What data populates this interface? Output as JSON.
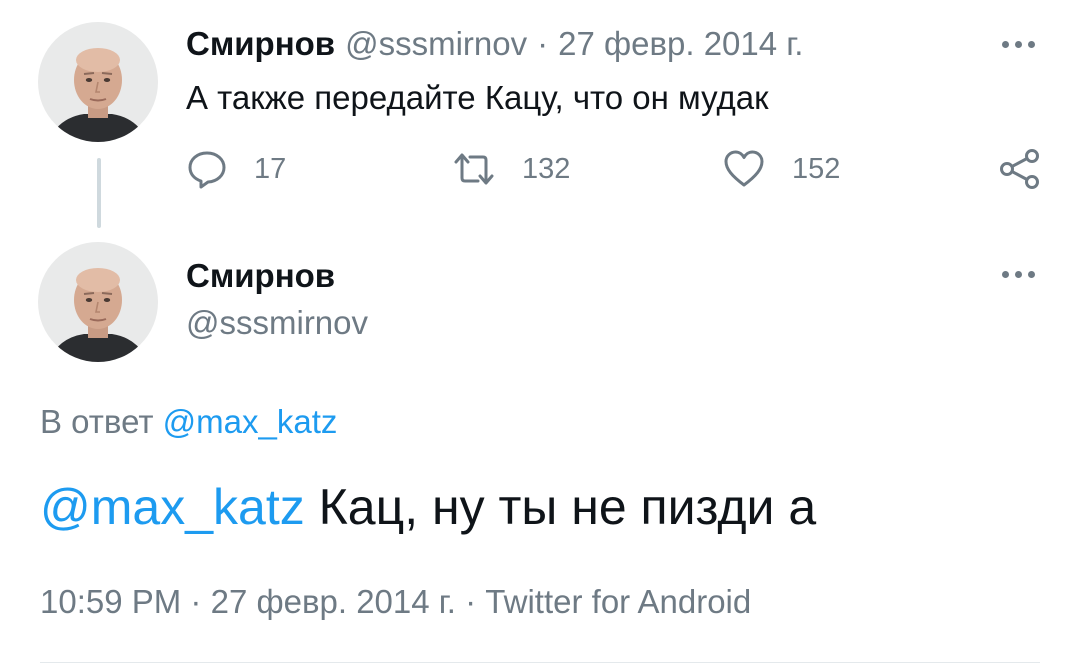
{
  "colors": {
    "text": "#0f1419",
    "muted": "#6e7a84",
    "link": "#1d9bf0",
    "thread_line": "#cfd9de"
  },
  "tweet1": {
    "avatar_icon": "avatar-photo",
    "name": "Смирнов",
    "handle": "@sssmirnov",
    "separator": "·",
    "date": "27 февр. 2014 г.",
    "text": "А также передайте Кацу, что он мудак",
    "more_icon": "more-dots-icon",
    "actions": {
      "reply": {
        "icon": "reply-icon",
        "count": "17"
      },
      "retweet": {
        "icon": "retweet-icon",
        "count": "132"
      },
      "like": {
        "icon": "heart-icon",
        "count": "152"
      },
      "share": {
        "icon": "share-icon"
      }
    }
  },
  "tweet2": {
    "avatar_icon": "avatar-photo",
    "name": "Смирнов",
    "handle": "@sssmirnov",
    "more_icon": "more-dots-icon",
    "reply_prefix": "В ответ",
    "reply_mention": "@max_katz",
    "text_mention": "@max_katz",
    "text_body": "Кац, ну ты не пизди а",
    "time": "10:59 PM",
    "meta_sep1": "·",
    "date": "27 февр. 2014 г.",
    "meta_sep2": "·",
    "source": "Twitter for Android"
  }
}
